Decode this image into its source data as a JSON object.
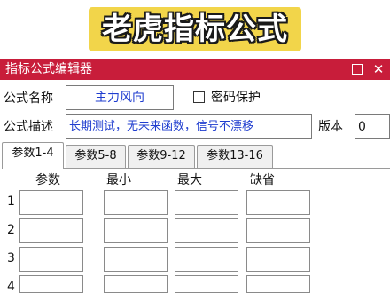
{
  "banner": {
    "title": "老虎指标公式"
  },
  "window": {
    "title": "指标公式编辑器",
    "maximize_label": "",
    "close_label": "✕"
  },
  "form": {
    "name_label": "公式名称",
    "name_value": "主力风向",
    "password_label": "密码保护",
    "password_checked": false,
    "desc_label": "公式描述",
    "desc_value": "长期测试，无未来函数，信号不漂移",
    "version_label": "版本",
    "version_value": "0"
  },
  "tabs": [
    {
      "label": "参数1-4",
      "active": true
    },
    {
      "label": "参数5-8",
      "active": false
    },
    {
      "label": "参数9-12",
      "active": false
    },
    {
      "label": "参数13-16",
      "active": false
    }
  ],
  "params": {
    "columns": [
      "参数",
      "最小",
      "最大",
      "缺省"
    ],
    "rows": [
      {
        "num": "1",
        "values": [
          "",
          "",
          "",
          ""
        ]
      },
      {
        "num": "2",
        "values": [
          "",
          "",
          "",
          ""
        ]
      },
      {
        "num": "3",
        "values": [
          "",
          "",
          "",
          ""
        ]
      },
      {
        "num": "4",
        "values": [
          "",
          "",
          "",
          ""
        ]
      }
    ]
  }
}
